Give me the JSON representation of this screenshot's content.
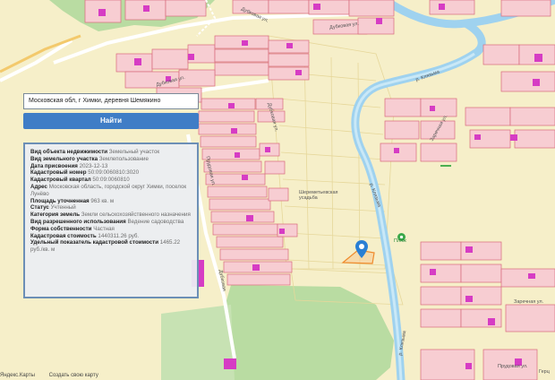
{
  "search": {
    "value": "Московская обл, г Химки, деревня Шемякино",
    "button_label": "Найти"
  },
  "info": {
    "rows": [
      {
        "key": "Вид объекта недвижимости",
        "value": "Земельный участок"
      },
      {
        "key": "Вид земельного участка",
        "value": "Землепользование"
      },
      {
        "key": "Дата присвоения",
        "value": "2023-12-13"
      },
      {
        "key": "Кадастровый номер",
        "value": "50:09:0060810:3020"
      },
      {
        "key": "Кадастровый квартал",
        "value": "50:09:0060810"
      },
      {
        "key": "Адрес",
        "value": "Московская область, городской округ Химки, поселок Лунёво"
      },
      {
        "key": "Площадь уточненная",
        "value": "963 кв. м"
      },
      {
        "key": "Статус",
        "value": "Учтенный"
      },
      {
        "key": "Категория земель",
        "value": "Земли сельскохозяйственного назначения"
      },
      {
        "key": "Вид разрешенного использования",
        "value": "Ведение садоводства"
      },
      {
        "key": "Форма собственности",
        "value": "Частная"
      },
      {
        "key": "Кадастровая стоимость",
        "value": "1440311.26 руб."
      },
      {
        "key": "Удельный показатель кадастровой стоимости",
        "value": "1465.22 руб./кв. м"
      }
    ]
  },
  "map_labels": {
    "dubkovaya_top": "Дубковая ул.",
    "dubkovaya_top2": "Дубковая ул.",
    "dubkovaya_mid": "Дубковая ул.",
    "dubkovaya_vertical": "Дубковая ул.",
    "prudovaya": "Прудовая ул.",
    "dubkovo_lower": "Дубковая",
    "estate": "Шереметьевская усадьба",
    "river1": "р. Клязьма",
    "river2": "р. Клязьма",
    "river3": "р. Клязьма",
    "zarechnaya1": "Заречная ул.",
    "zarechnaya2": "Заречная ул.",
    "beach": "Пляж",
    "prudovaya2": "Прудовая ул.",
    "gert": "Герц"
  },
  "footer": {
    "yandex": "Яндекс.Карты",
    "create": "Создать свою карту"
  },
  "colors": {
    "background": "#f6efc9",
    "parcel_fill": "#f7cdd2",
    "parcel_stroke": "#d86b7b",
    "building": "#d63cc4",
    "river": "#9fd2ef",
    "forest": "#b9dca2",
    "button": "#3f7dc6",
    "selected": "#ef8a2c"
  }
}
